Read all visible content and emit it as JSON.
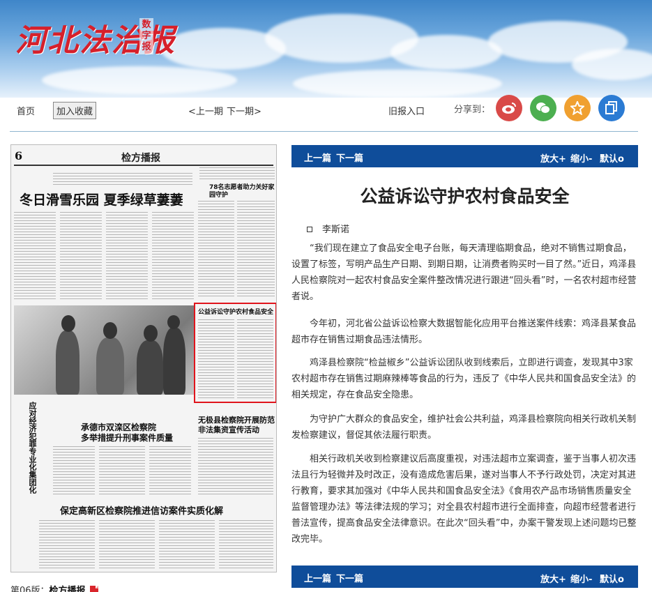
{
  "header": {
    "logo_text": "河北法治报",
    "logo_sub": "数字报"
  },
  "nav": {
    "home": "首页",
    "add_favorite": "加入收藏",
    "prev_issue": "<上一期",
    "next_issue": "下一期>",
    "old_issues": "旧报入口",
    "share_label": "分享到："
  },
  "share": [
    {
      "name": "weibo",
      "color": "#d94a48",
      "glyph": "◉"
    },
    {
      "name": "wechat",
      "color": "#4caf50",
      "glyph": "✉"
    },
    {
      "name": "favorite",
      "color": "#f0a030",
      "glyph": "☆"
    },
    {
      "name": "copy",
      "color": "#2b7bd3",
      "glyph": "❐"
    }
  ],
  "paper": {
    "page_num": "6",
    "section": "检方播报",
    "headline1": "冬日滑雪乐园  夏季绿草萋萋",
    "headline2": "78名志愿者助力关好家园守护",
    "headline3_line1": "承德市双滦区检察院",
    "headline3_line2": "多举措提升刑事案件质量",
    "headline4_line1": "无极县检察院开展防范",
    "headline4_line2": "非法集资宣传活动",
    "headline5": "保定高新区检察院推进信访案件实质化解",
    "vertical_headline": "应对经济犯罪专业化集团化",
    "highlighted_title": "公益诉讼守护农村食品安全",
    "caption_prefix": "第06版：",
    "caption_section": "检方播报"
  },
  "toolbar": {
    "prev": "上一篇",
    "next": "下一篇",
    "zoom_in": "放大+",
    "zoom_out": "缩小-",
    "zoom_default": "默认o"
  },
  "article": {
    "title": "公益诉讼守护农村食品安全",
    "author": "李斯诺",
    "paragraphs": [
      "“我们现在建立了食品安全电子台账，每天清理临期食品，绝对不销售过期食品，设置了标签，写明产品生产日期、到期日期，让消费者购买时一目了然。”近日，鸡泽县人民检察院对一起农村食品安全案件整改情况进行跟进“回头看”时，一名农村超市经营者说。",
      "今年初，河北省公益诉讼检察大数据智能化应用平台推送案件线索：鸡泽县某食品超市存在销售过期食品违法情形。",
      "鸡泽县检察院“检益椒乡”公益诉讼团队收到线索后，立即进行调查，发现其中3家农村超市存在销售过期麻辣棒等食品的行为，违反了《中华人民共和国食品安全法》的相关规定，存在食品安全隐患。",
      "为守护广大群众的食品安全，维护社会公共利益，鸡泽县检察院向相关行政机关制发检察建议，督促其依法履行职责。",
      "相关行政机关收到检察建议后高度重视，对违法超市立案调查，鉴于当事人初次违法且行为轻微并及时改正，没有造成危害后果，遂对当事人不予行政处罚，决定对其进行教育，要求其加强对《中华人民共和国食品安全法》《食用农产品市场销售质量安全监督管理办法》等法律法规的学习；对全县农村超市进行全面排查，向超市经营者进行普法宣传，提高食品安全法律意识。在此次“回头看”中，办案干警发现上述问题均已整改完毕。"
    ]
  }
}
